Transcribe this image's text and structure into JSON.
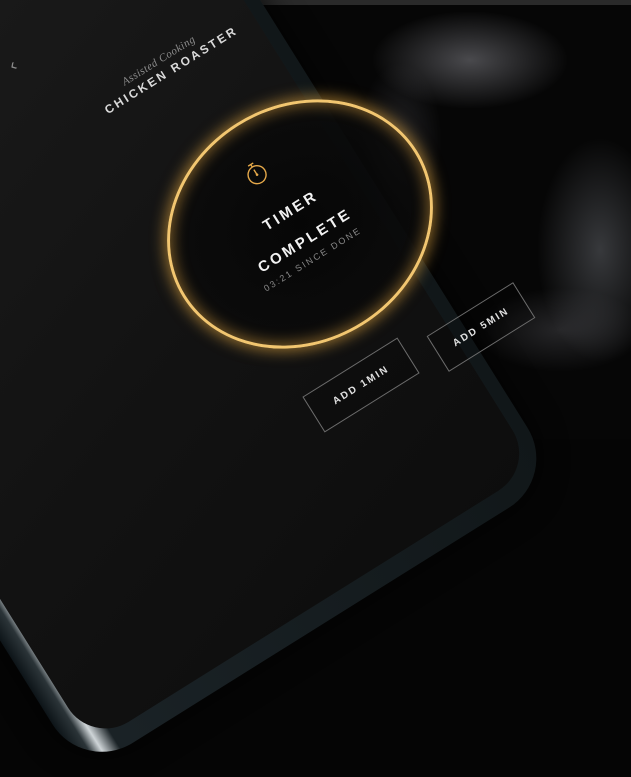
{
  "app": {
    "subtitle": "Assisted Cooking",
    "title": "CHICKEN ROASTER"
  },
  "timer": {
    "status_line1": "TIMER",
    "status_line2": "COMPLETE",
    "since_text": "03:21 SINCE DONE"
  },
  "actions": {
    "add_1min": "ADD 1MIN",
    "add_5min": "ADD 5MIN"
  },
  "colors": {
    "accent": "#f2c670",
    "screen_bg": "#151515",
    "text_primary": "#f2f2f2",
    "text_muted": "#8a8a8a"
  },
  "icons": {
    "back": "chevron-left-icon",
    "timer": "stopwatch-icon"
  }
}
